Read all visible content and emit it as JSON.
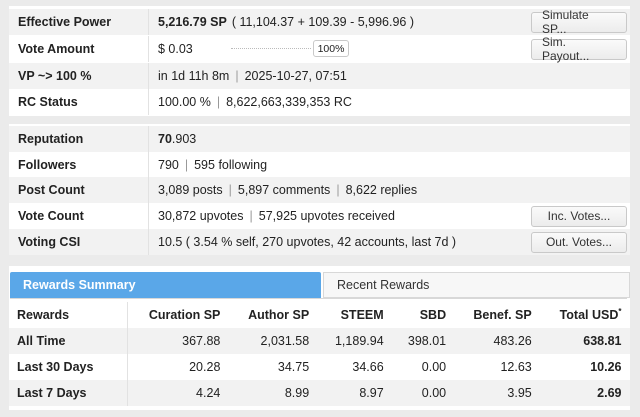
{
  "account": {
    "effective_power": {
      "label": "Effective Power",
      "value": "5,216.79 SP",
      "detail": "( 11,104.37 + 109.39 - 5,996.96 )",
      "button": "Simulate SP..."
    },
    "vote_amount": {
      "label": "Vote Amount",
      "value": "$ 0.03",
      "percent": "100%",
      "slider_fraction": 1.0,
      "button": "Sim. Payout..."
    },
    "vp": {
      "label": "VP ~> 100 %",
      "eta": "in 1d 11h 8m",
      "datetime": "2025-10-27, 07:51"
    },
    "rc_status": {
      "label": "RC Status",
      "percent": "100.00 %",
      "rc": "8,622,663,339,353 RC"
    }
  },
  "profile": {
    "reputation": {
      "label": "Reputation",
      "major": "70",
      "minor": ".903"
    },
    "followers": {
      "label": "Followers",
      "count": "790",
      "following": "595 following"
    },
    "post_count": {
      "label": "Post Count",
      "posts": "3,089 posts",
      "comments": "5,897 comments",
      "replies": "8,622 replies"
    },
    "vote_count": {
      "label": "Vote Count",
      "upvotes": "30,872 upvotes",
      "received": "57,925 upvotes received",
      "button": "Inc. Votes..."
    },
    "voting_csi": {
      "label": "Voting CSI",
      "value": "10.5 ( 3.54 % self, 270 upvotes, 42 accounts, last 7d )",
      "button": "Out. Votes..."
    }
  },
  "rewards": {
    "tabs": [
      {
        "label": "Rewards Summary",
        "active": true
      },
      {
        "label": "Recent Rewards",
        "active": false
      }
    ],
    "columns": [
      "Rewards",
      "Curation SP",
      "Author SP",
      "STEEM",
      "SBD",
      "Benef. SP",
      "Total USD"
    ],
    "total_marker": "*",
    "rows": [
      {
        "period": "All Time",
        "curation_sp": "367.88",
        "author_sp": "2,031.58",
        "steem": "1,189.94",
        "sbd": "398.01",
        "benef_sp": "483.26",
        "total_usd": "638.81"
      },
      {
        "period": "Last 30 Days",
        "curation_sp": "20.28",
        "author_sp": "34.75",
        "steem": "34.66",
        "sbd": "0.00",
        "benef_sp": "12.63",
        "total_usd": "10.26"
      },
      {
        "period": "Last 7 Days",
        "curation_sp": "4.24",
        "author_sp": "8.99",
        "steem": "8.97",
        "sbd": "0.00",
        "benef_sp": "3.95",
        "total_usd": "2.69"
      }
    ]
  }
}
